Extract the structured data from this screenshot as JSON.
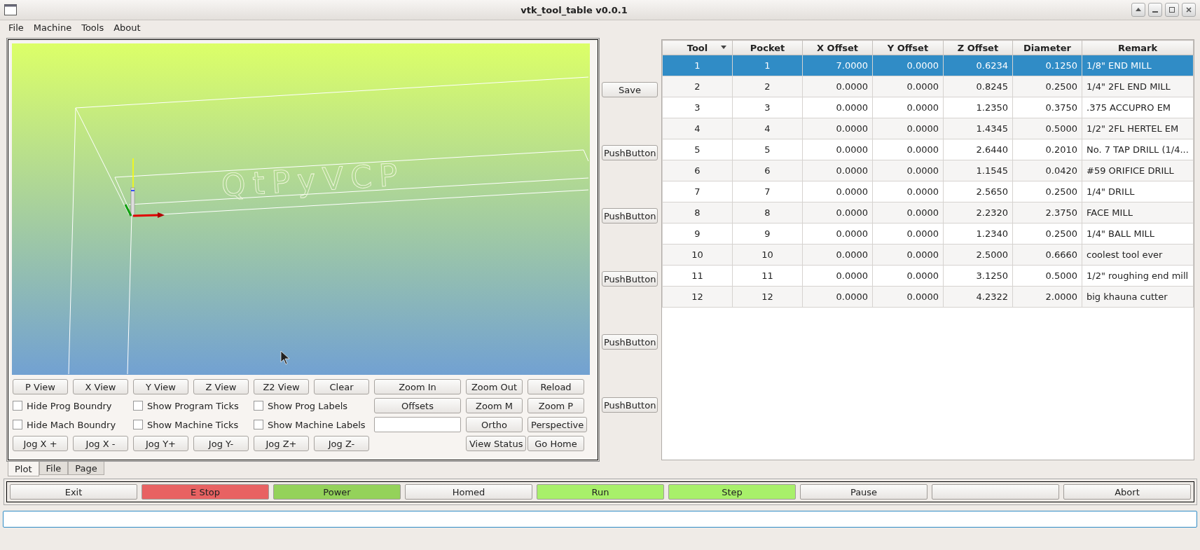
{
  "window": {
    "title": "vtk_tool_table v0.0.1"
  },
  "menu": [
    "File",
    "Machine",
    "Tools",
    "About"
  ],
  "viewport": {
    "label": "QtPyVCP"
  },
  "controls": [
    {
      "left": [
        {
          "kind": "button",
          "label": "P View"
        },
        {
          "kind": "button",
          "label": "X View"
        },
        {
          "kind": "button",
          "label": "Y View"
        },
        {
          "kind": "button",
          "label": "Z View"
        },
        {
          "kind": "button",
          "label": "Z2 View"
        },
        {
          "kind": "button",
          "label": "Clear"
        }
      ],
      "right": [
        {
          "kind": "button",
          "label": "Zoom In"
        },
        {
          "kind": "button",
          "label": "Zoom Out"
        },
        {
          "kind": "button",
          "label": "Reload"
        }
      ]
    },
    {
      "left": [
        {
          "kind": "checkbox",
          "label": "Hide Prog Boundry",
          "checked": false
        },
        {
          "kind": "checkbox",
          "label": "Show Program Ticks",
          "checked": false
        },
        {
          "kind": "checkbox",
          "label": "Show Prog Labels",
          "checked": false
        }
      ],
      "right": [
        {
          "kind": "button",
          "label": "Offsets"
        },
        {
          "kind": "button",
          "label": "Zoom M"
        },
        {
          "kind": "button",
          "label": "Zoom P"
        }
      ]
    },
    {
      "left": [
        {
          "kind": "checkbox",
          "label": "Hide Mach Boundry",
          "checked": false
        },
        {
          "kind": "checkbox",
          "label": "Show Machine Ticks",
          "checked": false
        },
        {
          "kind": "checkbox",
          "label": "Show Machine Labels",
          "checked": false
        }
      ],
      "right": [
        {
          "kind": "field"
        },
        {
          "kind": "button",
          "label": "Ortho"
        },
        {
          "kind": "button",
          "label": "Perspective"
        }
      ]
    },
    {
      "left": [
        {
          "kind": "button",
          "label": "Jog X +"
        },
        {
          "kind": "button",
          "label": "Jog X -"
        },
        {
          "kind": "button",
          "label": "Jog Y+"
        },
        {
          "kind": "button",
          "label": "Jog Y-"
        },
        {
          "kind": "button",
          "label": "Jog Z+"
        },
        {
          "kind": "button",
          "label": "Jog Z-"
        }
      ],
      "right": [
        {
          "kind": "button",
          "label": "View Status"
        },
        {
          "kind": "button",
          "label": "Go Home"
        }
      ]
    }
  ],
  "side_buttons": [
    "Save",
    "PushButton",
    "PushButton",
    "PushButton",
    "PushButton",
    "PushButton"
  ],
  "table": {
    "columns": [
      {
        "label": "Tool",
        "sorted": true
      },
      {
        "label": "Pocket",
        "sorted": false
      },
      {
        "label": "X Offset",
        "sorted": false
      },
      {
        "label": "Y Offset",
        "sorted": false
      },
      {
        "label": "Z Offset",
        "sorted": false
      },
      {
        "label": "Diameter",
        "sorted": false
      },
      {
        "label": "Remark",
        "sorted": false
      }
    ],
    "rows": [
      {
        "selected": true,
        "cells": [
          "1",
          "1",
          "7.0000",
          "0.0000",
          "0.6234",
          "0.1250",
          "1/8\" END MILL"
        ]
      },
      {
        "selected": false,
        "cells": [
          "2",
          "2",
          "0.0000",
          "0.0000",
          "0.8245",
          "0.2500",
          "1/4\" 2FL END MILL"
        ]
      },
      {
        "selected": false,
        "cells": [
          "3",
          "3",
          "0.0000",
          "0.0000",
          "1.2350",
          "0.3750",
          ".375 ACCUPRO EM"
        ]
      },
      {
        "selected": false,
        "cells": [
          "4",
          "4",
          "0.0000",
          "0.0000",
          "1.4345",
          "0.5000",
          "1/2\" 2FL HERTEL EM"
        ]
      },
      {
        "selected": false,
        "cells": [
          "5",
          "5",
          "0.0000",
          "0.0000",
          "2.6440",
          "0.2010",
          "No. 7 TAP DRILL (1/4..."
        ]
      },
      {
        "selected": false,
        "cells": [
          "6",
          "6",
          "0.0000",
          "0.0000",
          "1.1545",
          "0.0420",
          "#59 ORIFICE DRILL"
        ]
      },
      {
        "selected": false,
        "cells": [
          "7",
          "7",
          "0.0000",
          "0.0000",
          "2.5650",
          "0.2500",
          "1/4\" DRILL"
        ]
      },
      {
        "selected": false,
        "cells": [
          "8",
          "8",
          "0.0000",
          "0.0000",
          "2.2320",
          "2.3750",
          "FACE MILL"
        ]
      },
      {
        "selected": false,
        "cells": [
          "9",
          "9",
          "0.0000",
          "0.0000",
          "1.2340",
          "0.2500",
          "1/4\" BALL MILL"
        ]
      },
      {
        "selected": false,
        "cells": [
          "10",
          "10",
          "0.0000",
          "0.0000",
          "2.5000",
          "0.6660",
          "coolest tool ever"
        ]
      },
      {
        "selected": false,
        "cells": [
          "11",
          "11",
          "0.0000",
          "0.0000",
          "3.1250",
          "0.5000",
          "1/2\" roughing end mill"
        ]
      },
      {
        "selected": false,
        "cells": [
          "12",
          "12",
          "0.0000",
          "0.0000",
          "4.2322",
          "2.0000",
          "big khauna cutter"
        ]
      }
    ]
  },
  "tabs": [
    {
      "label": "Plot",
      "selected": true
    },
    {
      "label": "File",
      "selected": false
    },
    {
      "label": "Page",
      "selected": false
    }
  ],
  "bottom_buttons": [
    {
      "kind": "labeled",
      "label": "Exit"
    },
    {
      "kind": "labeled",
      "label": "E Stop",
      "color": "#e86262"
    },
    {
      "kind": "labeled",
      "label": "Power",
      "color": "#94d25a"
    },
    {
      "kind": "labeled",
      "label": "Homed"
    },
    {
      "kind": "labeled",
      "label": "Run",
      "color": "#a8f06a"
    },
    {
      "kind": "labeled",
      "label": "Step",
      "color": "#a8f06a"
    },
    {
      "kind": "labeled",
      "label": "Pause"
    },
    {
      "kind": "blank"
    },
    {
      "kind": "labeled",
      "label": "Abort"
    }
  ],
  "command_field": {
    "focused": true
  }
}
